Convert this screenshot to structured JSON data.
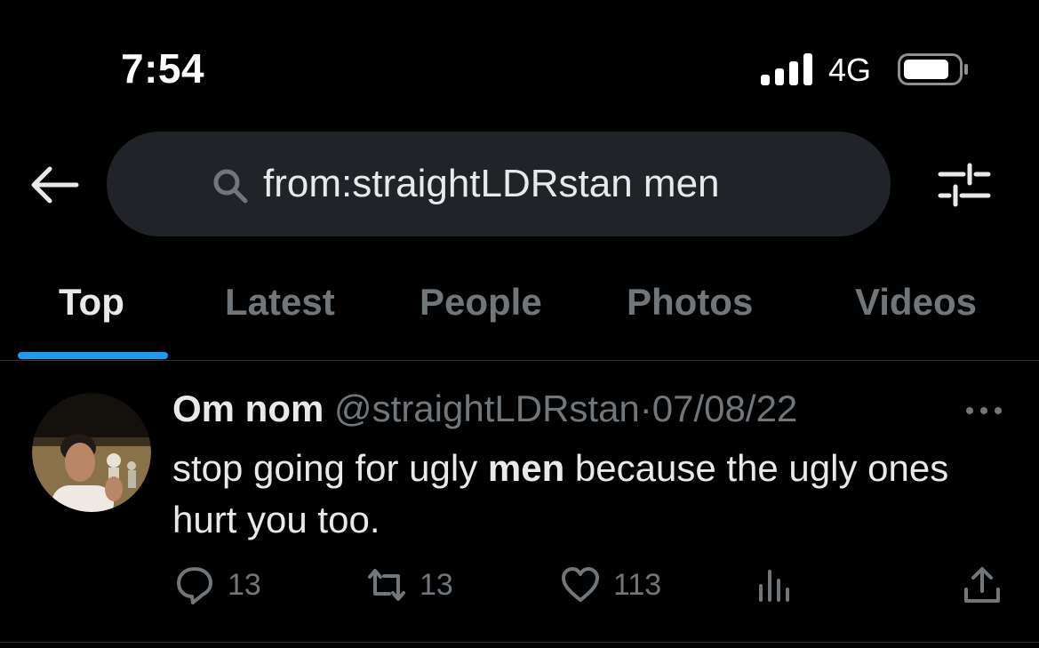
{
  "status_bar": {
    "time": "7:54",
    "network": "4G"
  },
  "search": {
    "query": "from:straightLDRstan men"
  },
  "tabs": [
    {
      "label": "Top",
      "active": true
    },
    {
      "label": "Latest",
      "active": false
    },
    {
      "label": "People",
      "active": false
    },
    {
      "label": "Photos",
      "active": false
    },
    {
      "label": "Videos",
      "active": false
    }
  ],
  "tweet": {
    "display_name": "Om nom",
    "handle": "@straightLDRstan",
    "separator": "·",
    "date": "07/08/22",
    "text_before": "stop going for ugly ",
    "text_bold": "men",
    "text_after": " because the ugly ones hurt you too.",
    "replies": "13",
    "retweets": "13",
    "likes": "113"
  },
  "colors": {
    "accent": "#1d9bf0",
    "muted": "#71767b",
    "search_bg": "#202327"
  },
  "icons": [
    "back-arrow-icon",
    "search-icon",
    "filter-sliders-icon",
    "more-dots-icon",
    "reply-icon",
    "retweet-icon",
    "like-icon",
    "views-icon",
    "share-icon",
    "signal-icon",
    "battery-icon"
  ]
}
